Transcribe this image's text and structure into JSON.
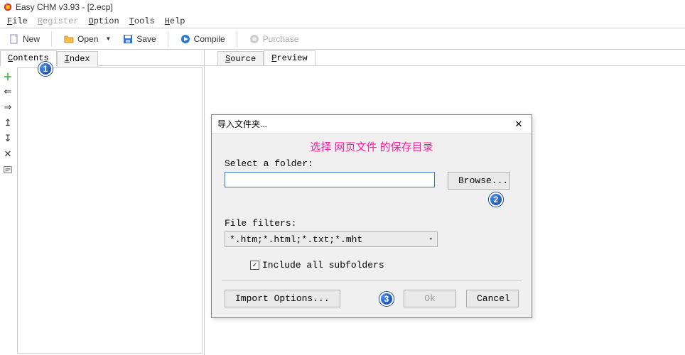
{
  "window": {
    "title": "Easy CHM v3.93 - [2.ecp]"
  },
  "menu": {
    "file": "File",
    "register": "Register",
    "option": "Option",
    "tools": "Tools",
    "help": "Help"
  },
  "toolbar": {
    "new": "New",
    "open": "Open",
    "save": "Save",
    "compile": "Compile",
    "purchase": "Purchase"
  },
  "left_tabs": {
    "contents": "Contents",
    "index": "Index"
  },
  "right_tabs": {
    "source": "Source",
    "preview": "Preview"
  },
  "modal": {
    "title": "导入文件夹...",
    "annotation": "选择 网页文件 的保存目录",
    "select_label": "Select a folder:",
    "folder_value": "",
    "browse": "Browse...",
    "filters_label": "File filters:",
    "filter_value": "*.htm;*.html;*.txt;*.mht",
    "include_sub": "Include all subfolders",
    "include_sub_checked": true,
    "import_options": "Import Options...",
    "ok": "Ok",
    "cancel": "Cancel"
  },
  "badges": {
    "b1": "1",
    "b2": "2",
    "b3": "3"
  }
}
